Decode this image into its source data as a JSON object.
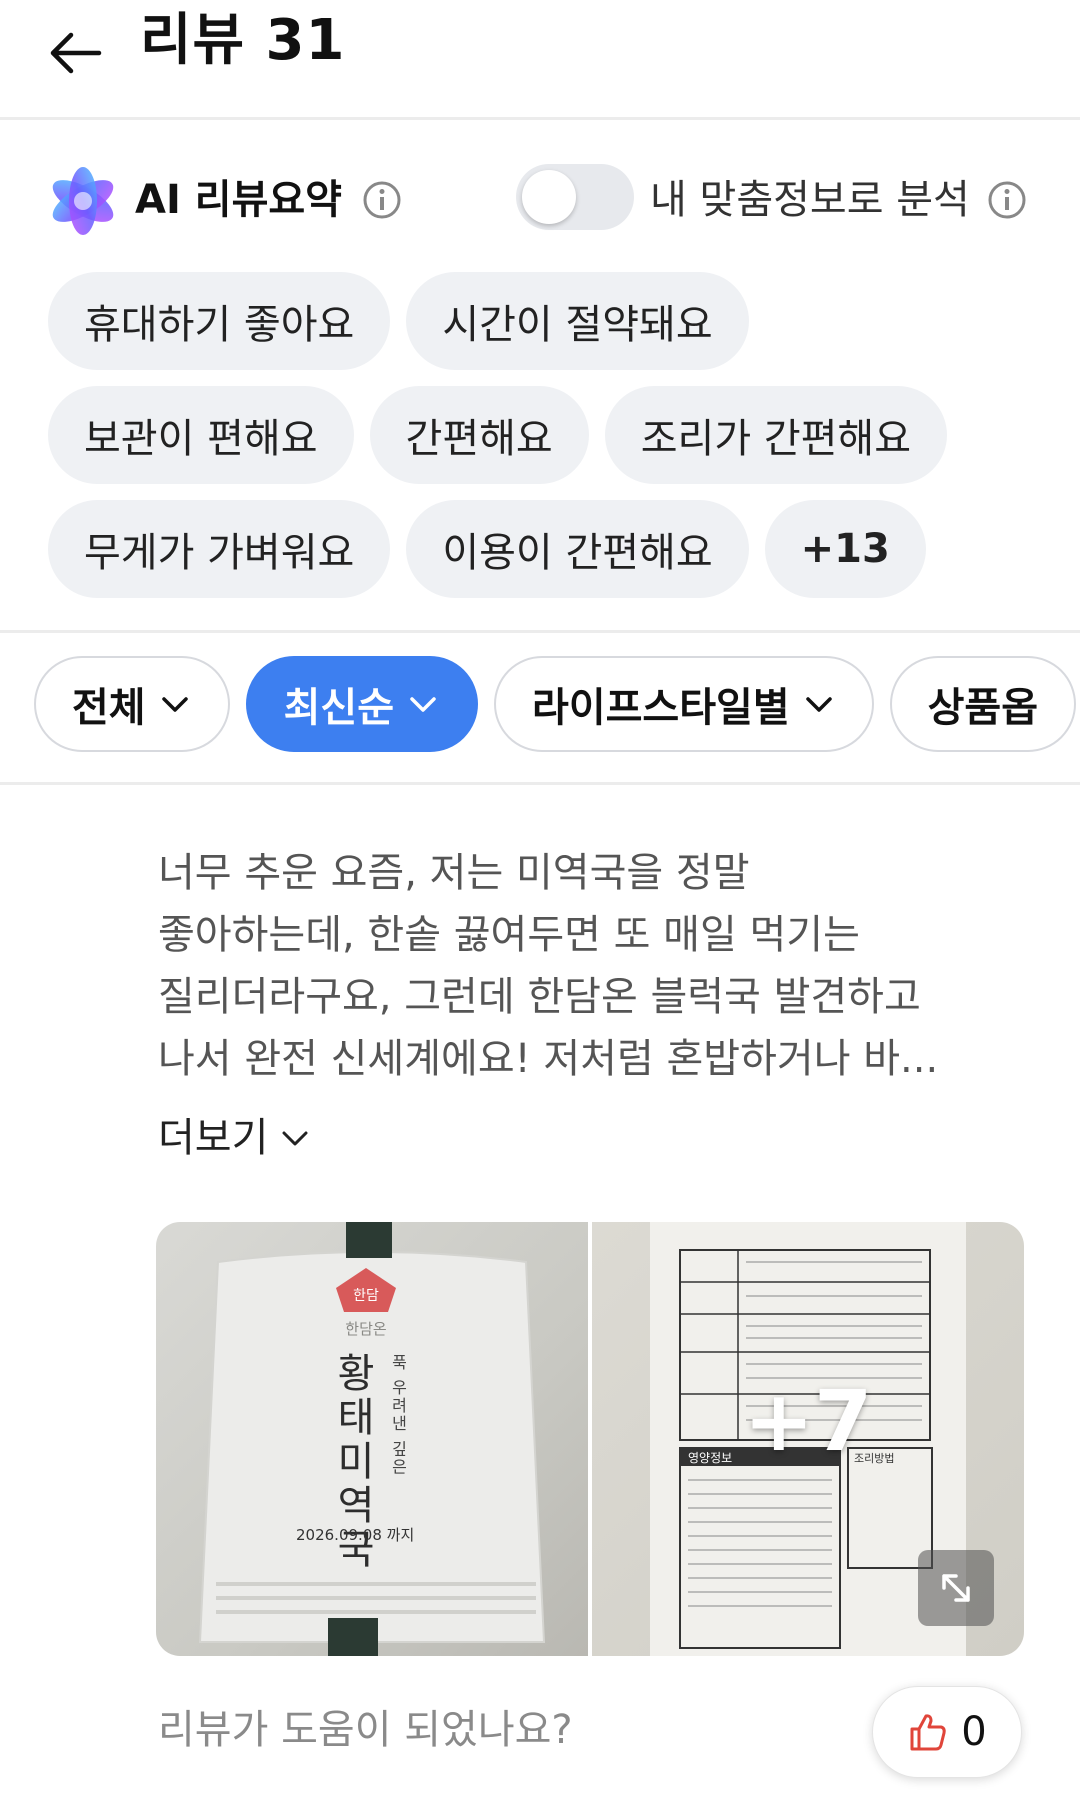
{
  "header": {
    "title": "리뷰 31"
  },
  "ai_summary": {
    "title": "AI 리뷰요약",
    "personal_label": "내 맞춤정보로 분석",
    "toggle_on": false,
    "tags": [
      [
        "휴대하기 좋아요",
        "시간이 절약돼요"
      ],
      [
        "보관이 편해요",
        "간편해요",
        "조리가 간편해요"
      ],
      [
        "무게가 가벼워요",
        "이용이 간편해요",
        "+13"
      ]
    ]
  },
  "filters": {
    "items": [
      {
        "label": "전체",
        "active": false
      },
      {
        "label": "최신순",
        "active": true
      },
      {
        "label": "라이프스타일별",
        "active": false
      },
      {
        "label": "상품옵",
        "active": false
      }
    ]
  },
  "review": {
    "text_lines": [
      "너무 추운 요즘, 저는 미역국을 정말",
      "좋아하는데, 한솥 끓여두면 또 매일 먹기는",
      "질리더라구요, 그런데 한담온 블럭국 발견하고",
      "나서 완전 신세계에요! 저처럼 혼밥하거나 바..."
    ],
    "more_label": "더보기",
    "photo1": {
      "brand_badge": "한담",
      "brand": "한담온",
      "product_name": "황태미역국",
      "tagline": "푹 우려낸 깊은",
      "date": "2026.09.08 까지"
    },
    "photo2": {
      "more_count": "+7",
      "nutrition_label": "영양정보",
      "cooking_label": "조리방법"
    },
    "helpful_question": "리뷰가 도움이 되었나요?",
    "like_count": "0"
  },
  "colors": {
    "accent": "#3d7ff0",
    "chip_bg": "#eff1f4",
    "muted_text": "#555555"
  }
}
